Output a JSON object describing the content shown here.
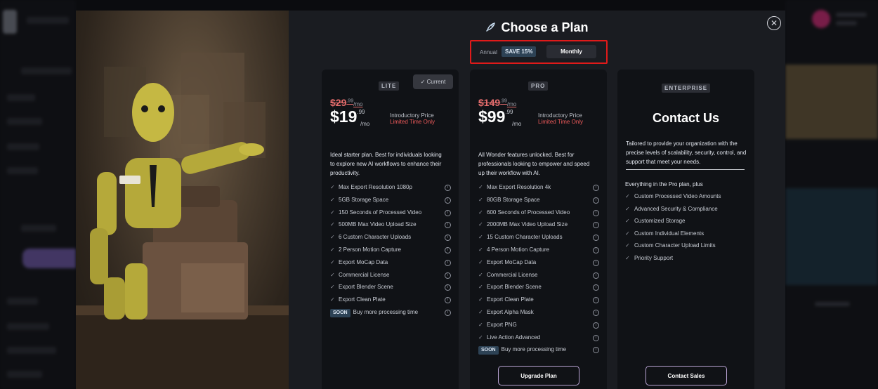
{
  "modal": {
    "title": "Choose a Plan",
    "close_icon": "close-icon",
    "rocket_icon": "rocket-icon"
  },
  "billing_toggle": {
    "annual_label": "Annual",
    "save_badge": "SAVE 15%",
    "monthly_label": "Monthly",
    "selected": "Monthly"
  },
  "plans": {
    "lite": {
      "tier": "LITE",
      "current_label": "Current",
      "old_price": "$29",
      "old_cents": ".99",
      "old_period": "/mo",
      "price": "$19",
      "cents": ".99",
      "period": "/mo",
      "intro_label": "Introductory Price",
      "limited_label": "Limited Time Only",
      "description": "Ideal starter plan. Best for individuals looking to explore new AI workflows to enhance their productivity.",
      "features": [
        "Max Export Resolution 1080p",
        "5GB Storage Space",
        "150 Seconds of Processed Video",
        "500MB Max Video Upload Size",
        "6 Custom Character Uploads",
        "2 Person Motion Capture",
        "Export MoCap Data",
        "Commercial License",
        "Export Blender Scene",
        "Export Clean Plate"
      ],
      "soon_badge": "SOON",
      "soon_text": "Buy more processing time"
    },
    "pro": {
      "tier": "PRO",
      "old_price": "$149",
      "old_cents": ".99",
      "old_period": "/mo",
      "price": "$99",
      "cents": ".99",
      "period": "/mo",
      "intro_label": "Introductory Price",
      "limited_label": "Limited Time Only",
      "description": "All Wonder features unlocked. Best for professionals looking to empower and speed up their workflow with AI.",
      "features": [
        "Max Export Resolution 4k",
        "80GB Storage Space",
        "600 Seconds of Processed Video",
        "2000MB Max Video Upload Size",
        "15 Custom Character Uploads",
        "4 Person Motion Capture",
        "Export MoCap Data",
        "Commercial License",
        "Export Blender Scene",
        "Export Clean Plate",
        "Export Alpha Mask",
        "Export PNG",
        "Live Action Advanced"
      ],
      "soon_badge": "SOON",
      "soon_text": "Buy more processing time",
      "cta": "Upgrade Plan"
    },
    "enterprise": {
      "tier": "ENTERPRISE",
      "heading": "Contact Us",
      "description": "Tailored to provide your organization with the precise levels of scalability, security, control, and support that meet your needs.",
      "features_heading": "Everything in the Pro plan, plus",
      "features": [
        "Custom Processed Video Amounts",
        "Advanced Security & Compliance",
        "Customized Storage",
        "Custom Individual Elements",
        "Custom Character Upload Limits",
        "Priority Support"
      ],
      "cta": "Contact Sales"
    }
  },
  "colors": {
    "accent_red": "#e01a1a",
    "price_strike": "#e56d6d",
    "badge_blue": "#2d4255",
    "cta_border": "#b9a4d4"
  }
}
